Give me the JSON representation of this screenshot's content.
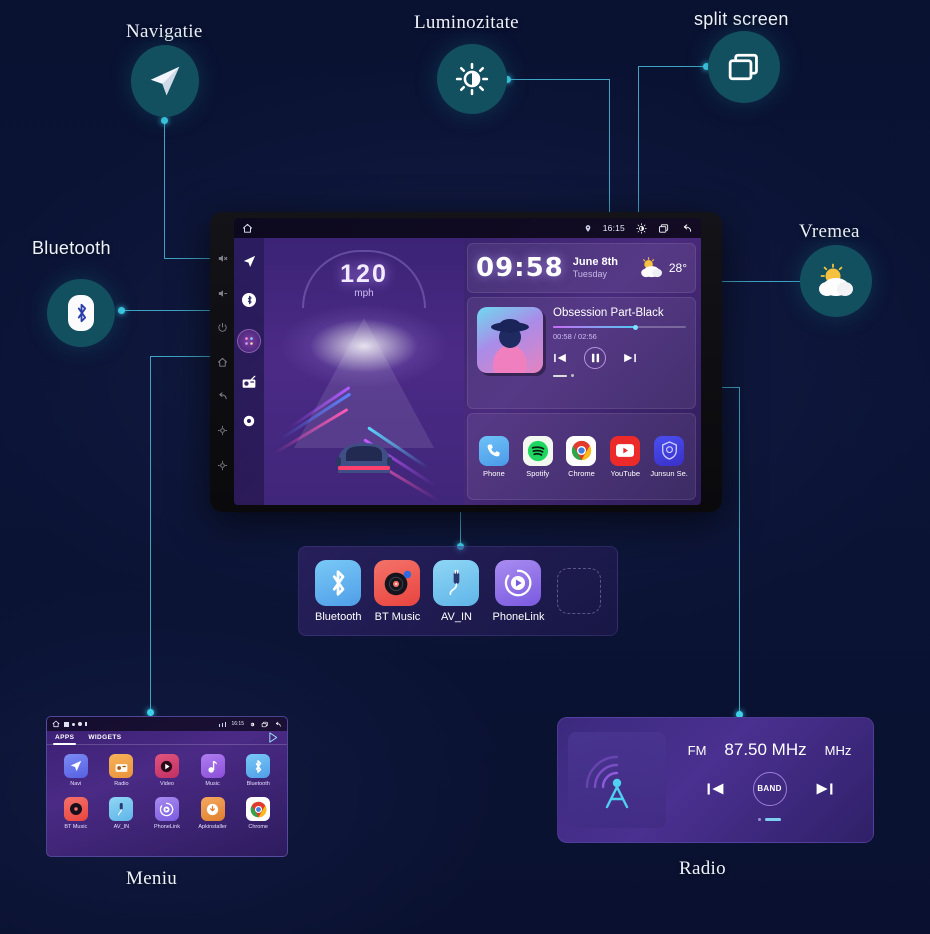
{
  "callouts": [
    {
      "id": "navigatie",
      "label": "Navigatie",
      "icon": "navigation-arrow-icon"
    },
    {
      "id": "luminozitate",
      "label": "Luminozitate",
      "icon": "brightness-sun-icon"
    },
    {
      "id": "split_screen",
      "label": "split screen",
      "icon": "split-screen-icon"
    },
    {
      "id": "bluetooth",
      "label": "Bluetooth",
      "icon": "bluetooth-icon"
    },
    {
      "id": "vremea",
      "label": "Vremea",
      "icon": "sun-cloud-icon"
    },
    {
      "id": "meniu",
      "label": "Meniu",
      "icon": "menu-grid-icon"
    },
    {
      "id": "radio",
      "label": "Radio",
      "icon": "radio-icon"
    }
  ],
  "head_unit": {
    "status_bar": {
      "location_icon": "location-pin-icon",
      "time": "16:15",
      "brightness_icon": "brightness-icon",
      "split_screen_icon": "split-screen-icon",
      "back_icon": "back-arrow-icon",
      "home_icon": "home-icon"
    },
    "sidebar_items": [
      {
        "name": "navigation",
        "icon": "navigation-arrow-icon",
        "active": false
      },
      {
        "name": "bluetooth",
        "icon": "bluetooth-icon",
        "active": false
      },
      {
        "name": "apps",
        "icon": "apps-grid-icon",
        "active": true
      },
      {
        "name": "radio",
        "icon": "radio-icon",
        "active": false
      },
      {
        "name": "settings",
        "icon": "gear-circle-icon",
        "active": false
      }
    ],
    "speedometer": {
      "value": "120",
      "unit": "mph"
    },
    "clock_card": {
      "time": "09:58",
      "date": "June 8th",
      "weekday": "Tuesday",
      "weather_icon": "sun-cloud-icon",
      "temperature": "28°"
    },
    "media_card": {
      "track_title": "Obsession Part-Black",
      "elapsed_total": "00:58 / 02:56",
      "progress_percent": 62,
      "prev_icon": "skip-previous-icon",
      "play_pause_icon": "pause-icon",
      "next_icon": "skip-next-icon",
      "volume_icon": "volume-slider-icon"
    },
    "apps": [
      {
        "label": "Phone",
        "icon": "phone-icon"
      },
      {
        "label": "Spotify",
        "icon": "spotify-icon"
      },
      {
        "label": "Chrome",
        "icon": "chrome-icon"
      },
      {
        "label": "YouTube",
        "icon": "youtube-icon"
      },
      {
        "label": "Junsun Se.",
        "icon": "junsun-service-icon"
      }
    ]
  },
  "dock": {
    "items": [
      {
        "label": "Bluetooth",
        "icon": "bluetooth-icon"
      },
      {
        "label": "BT Music",
        "icon": "bt-music-vinyl-icon"
      },
      {
        "label": "AV_IN",
        "icon": "av-in-plug-icon"
      },
      {
        "label": "PhoneLink",
        "icon": "phonelink-play-icon"
      }
    ],
    "empty_slot": true
  },
  "menu_screen": {
    "tabs": [
      {
        "label": "APPS",
        "active": true
      },
      {
        "label": "WIDGETS",
        "active": false
      }
    ],
    "status_time": "16:15",
    "play_store_icon": "play-store-icon",
    "apps": [
      {
        "label": "Navi",
        "icon": "navigation-arrow-icon"
      },
      {
        "label": "Radio",
        "icon": "radio-icon"
      },
      {
        "label": "Video",
        "icon": "video-play-icon"
      },
      {
        "label": "Music",
        "icon": "music-note-icon"
      },
      {
        "label": "Bluetooth",
        "icon": "bluetooth-icon"
      },
      {
        "label": "BT Music",
        "icon": "bt-music-vinyl-icon"
      },
      {
        "label": "AV_IN",
        "icon": "av-in-plug-icon"
      },
      {
        "label": "PhoneLink",
        "icon": "phonelink-play-icon"
      },
      {
        "label": "Apkinstaller",
        "icon": "apk-installer-icon"
      },
      {
        "label": "Chrome",
        "icon": "chrome-icon"
      }
    ]
  },
  "radio_widget": {
    "band": "FM",
    "frequency": "87.50 MHz",
    "unit": "MHz",
    "band_button": "BAND",
    "prev_icon": "skip-previous-icon",
    "next_icon": "skip-next-icon",
    "tower_icon": "radio-tower-icon"
  },
  "colors": {
    "background": "#0b1436",
    "badge": "#13505f",
    "connector": "#3fa3c4",
    "dot": "#3fd0ea",
    "accent_purple": "#8a4fd8"
  }
}
